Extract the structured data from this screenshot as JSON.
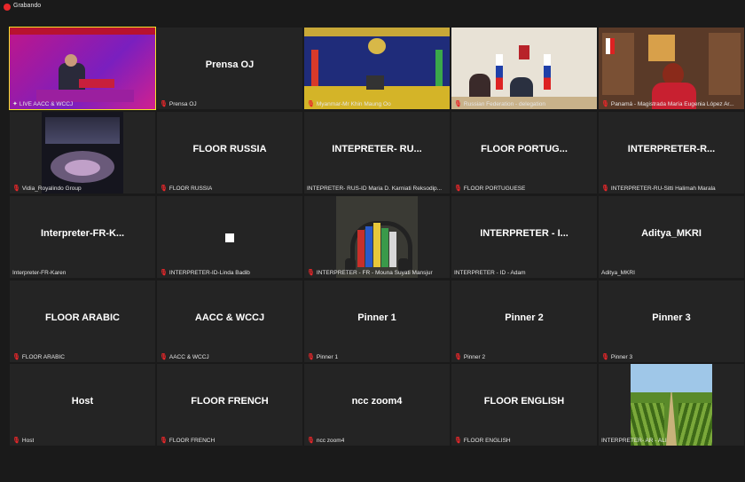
{
  "recording": {
    "label": "Grabando",
    "dot_color": "#e8272a"
  },
  "active_speaker_color": "#f5e22a",
  "tiles": [
    {
      "name": "",
      "label": "LIVE AACC & WCCJ",
      "muted": false,
      "pinned": true
    },
    {
      "name": "Prensa OJ",
      "label": "Prensa OJ",
      "muted": true
    },
    {
      "name": "",
      "label": "Myanmar-Mr Khin Maung Oo",
      "muted": true
    },
    {
      "name": "",
      "label": "Russian Federation - delegation",
      "muted": true
    },
    {
      "name": "",
      "label": "Panamá - Magistrada María Eugenia López Ar...",
      "muted": true
    },
    {
      "name": "",
      "label": "Vidia_Royalindo Group",
      "muted": true
    },
    {
      "name": "FLOOR RUSSIA",
      "label": "FLOOR RUSSIA",
      "muted": true
    },
    {
      "name": "INTEPRETER- RU...",
      "label": "INTEPRETER- RUS-ID  Maria D. Karniati Reksodip...",
      "muted": false
    },
    {
      "name": "FLOOR PORTUG...",
      "label": "FLOOR PORTUGUESE",
      "muted": true
    },
    {
      "name": "INTERPRETER-R...",
      "label": "INTERPRETER-RU-Sitti Halimah Marala",
      "muted": true
    },
    {
      "name": "Interpreter-FR-K...",
      "label": "Interpreter-FR-Karen",
      "muted": false
    },
    {
      "name": "",
      "label": "INTERPRETER-ID-Linda Badib",
      "muted": true
    },
    {
      "name": "",
      "label": "INTERPRETER - FR - Mouna Suyati Mansjur",
      "muted": true
    },
    {
      "name": "INTERPRETER - I...",
      "label": "INTERPRETER - ID - Adam",
      "muted": false
    },
    {
      "name": "Aditya_MKRI",
      "label": "Aditya_MKRI",
      "muted": false
    },
    {
      "name": "FLOOR ARABIC",
      "label": "FLOOR ARABIC",
      "muted": true
    },
    {
      "name": "AACC & WCCJ",
      "label": "AACC & WCCJ",
      "muted": true
    },
    {
      "name": "Pinner 1",
      "label": "Pinner 1",
      "muted": true
    },
    {
      "name": "Pinner 2",
      "label": "Pinner 2",
      "muted": true
    },
    {
      "name": "Pinner 3",
      "label": "Pinner 3",
      "muted": true
    },
    {
      "name": "Host",
      "label": "Host",
      "muted": true
    },
    {
      "name": "FLOOR FRENCH",
      "label": "FLOOR FRENCH",
      "muted": true
    },
    {
      "name": "ncc zoom4",
      "label": "ncc zoom4",
      "muted": true
    },
    {
      "name": "FLOOR ENGLISH",
      "label": "FLOOR ENGLISH",
      "muted": true
    },
    {
      "name": "",
      "label": "INTERPRETER- AR - ALI",
      "muted": false
    }
  ],
  "icons": {
    "mic_off": "mic-off-icon",
    "pin": "pin-icon"
  }
}
